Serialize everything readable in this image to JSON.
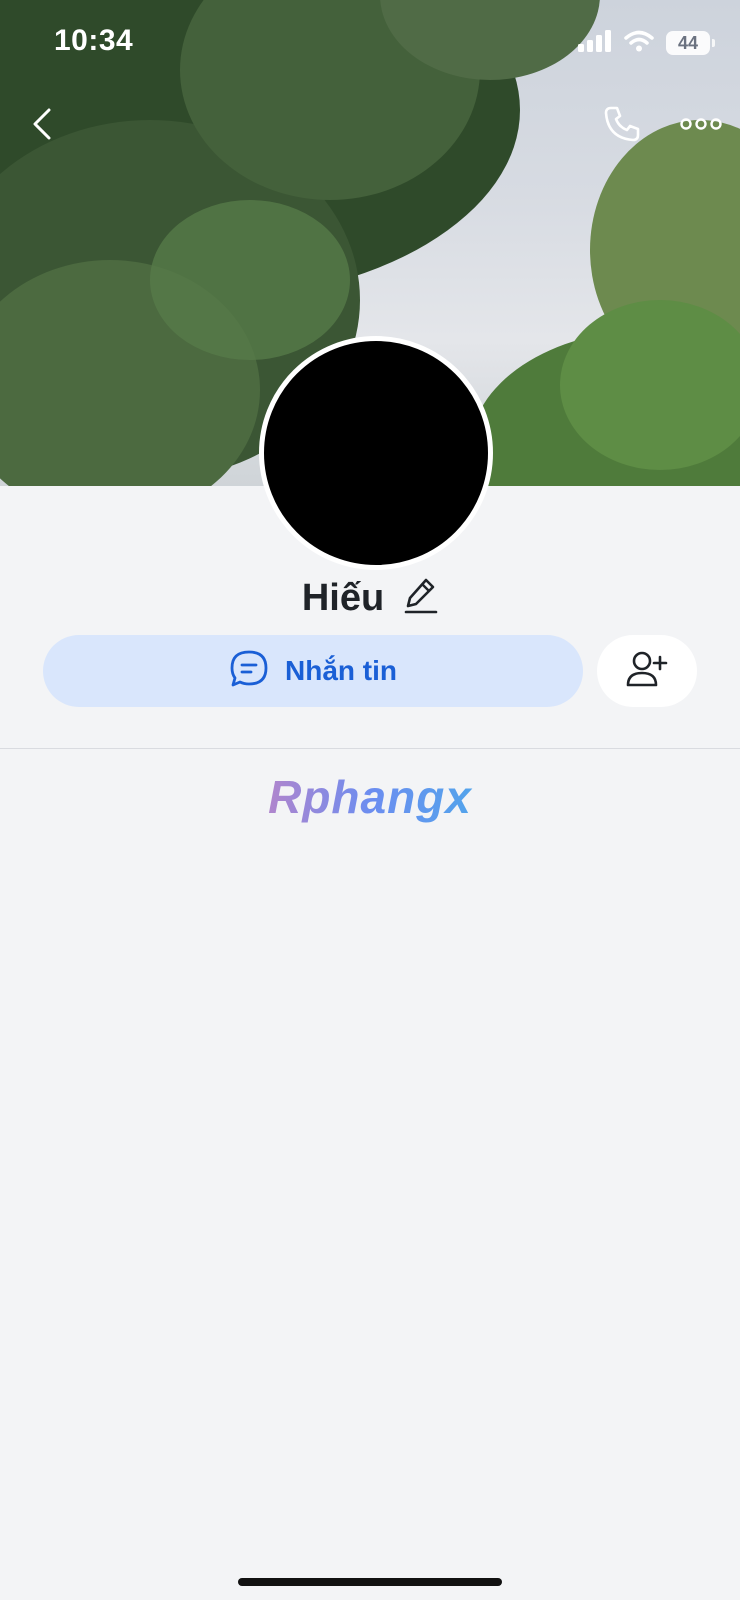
{
  "status_bar": {
    "time": "10:34",
    "battery": "44"
  },
  "profile": {
    "name": "Hiếu"
  },
  "actions": {
    "message_label": "Nhắn tin"
  },
  "watermark": "Rphangx",
  "colors": {
    "accent": "#1a5fd6",
    "message_button_bg": "#d9e6fc",
    "page_bg": "#f3f4f6"
  },
  "icons": [
    "back-icon",
    "phone-icon",
    "more-icon",
    "edit-icon",
    "chat-icon",
    "add-friend-icon",
    "signal-icon",
    "wifi-icon",
    "battery-icon"
  ]
}
